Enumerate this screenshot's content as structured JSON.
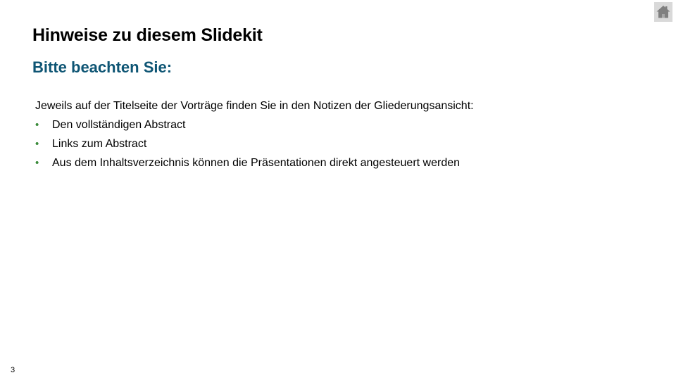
{
  "slide": {
    "title": "Hinweise zu diesem Slidekit",
    "subtitle": "Bitte beachten Sie:",
    "intro": "Jeweils auf der Titelseite der Vorträge finden Sie in den Notizen der Gliederungsansicht:",
    "bullets": [
      "Den vollständigen Abstract",
      "Links zum Abstract",
      "Aus dem Inhaltsverzeichnis können die Präsentationen direkt angesteuert werden"
    ],
    "bullet_char": "•",
    "page_number": "3"
  },
  "icons": {
    "home": "home-icon"
  },
  "colors": {
    "subtitle": "#0e5574",
    "bullet": "#3a8b3a",
    "home_button_bg": "#d9d9d9",
    "home_icon": "#7f7f7f"
  }
}
